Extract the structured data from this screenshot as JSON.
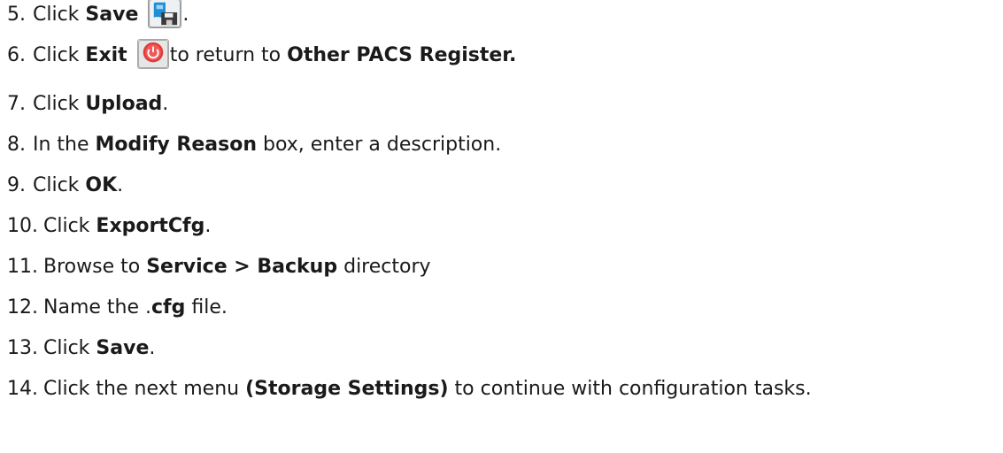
{
  "steps": [
    {
      "num": "5.",
      "parts": [
        {
          "t": "Click "
        },
        {
          "b": "Save"
        },
        {
          "icon": "save-disk-icon"
        },
        {
          "t": "."
        }
      ]
    },
    {
      "num": "6.",
      "parts": [
        {
          "t": "Click "
        },
        {
          "b": "Exit"
        },
        {
          "icon": "exit-power-icon"
        },
        {
          "t": "to return to "
        },
        {
          "b": "Other PACS Register."
        }
      ]
    },
    {
      "num": "7.",
      "parts": [
        {
          "t": "Click "
        },
        {
          "b": "Upload"
        },
        {
          "t": "."
        }
      ]
    },
    {
      "num": "8.",
      "parts": [
        {
          "t": "In the "
        },
        {
          "b": "Modify Reason"
        },
        {
          "t": " box, enter a description."
        }
      ]
    },
    {
      "num": "9.",
      "parts": [
        {
          "t": "Click "
        },
        {
          "b": "OK"
        },
        {
          "t": "."
        }
      ]
    },
    {
      "num": "10.",
      "parts": [
        {
          "t": "Click "
        },
        {
          "b": "ExportCfg"
        },
        {
          "t": "."
        }
      ]
    },
    {
      "num": "11.",
      "parts": [
        {
          "t": "Browse to "
        },
        {
          "b": "Service > Backup"
        },
        {
          "t": " directory"
        }
      ]
    },
    {
      "num": "12.",
      "parts": [
        {
          "t": "Name the ."
        },
        {
          "b": "cfg"
        },
        {
          "t": " file."
        }
      ]
    },
    {
      "num": "13.",
      "parts": [
        {
          "t": "Click "
        },
        {
          "b": "Save"
        },
        {
          "t": "."
        }
      ]
    },
    {
      "num": "14.",
      "parts": [
        {
          "t": "Click the next menu "
        },
        {
          "b": "(Storage Settings)"
        },
        {
          "t": " to continue with configuration tasks."
        }
      ]
    }
  ]
}
